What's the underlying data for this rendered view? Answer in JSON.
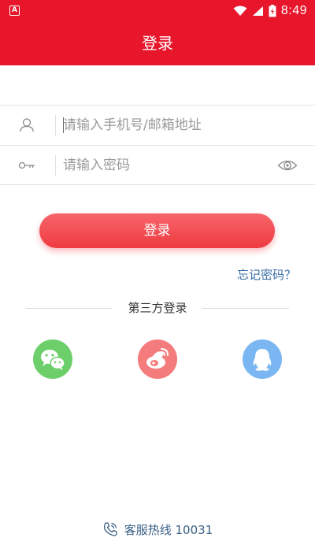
{
  "status_bar": {
    "time": "8:49",
    "left_icon_letter": "A",
    "icons": [
      "app-notification-icon",
      "wifi-icon",
      "signal-icon",
      "battery-charging-icon"
    ]
  },
  "header": {
    "title": "登录",
    "background_color": "#e8162b"
  },
  "form": {
    "username_placeholder": "请输入手机号/邮箱地址",
    "username_value": "",
    "password_placeholder": "请输入密码",
    "password_value": "",
    "login_label": "登录",
    "forgot_label": "忘记密码？",
    "accent_color": "#ee3a41"
  },
  "third_party": {
    "label": "第三方登录",
    "providers": [
      {
        "name": "wechat",
        "icon": "wechat-icon",
        "color": "#6dcf69"
      },
      {
        "name": "weibo",
        "icon": "weibo-icon",
        "color": "#f47c7c"
      },
      {
        "name": "qq",
        "icon": "qq-icon",
        "color": "#7ab7f2"
      }
    ]
  },
  "footer": {
    "hotline_label": "客服热线 10031",
    "icon": "phone-icon"
  }
}
